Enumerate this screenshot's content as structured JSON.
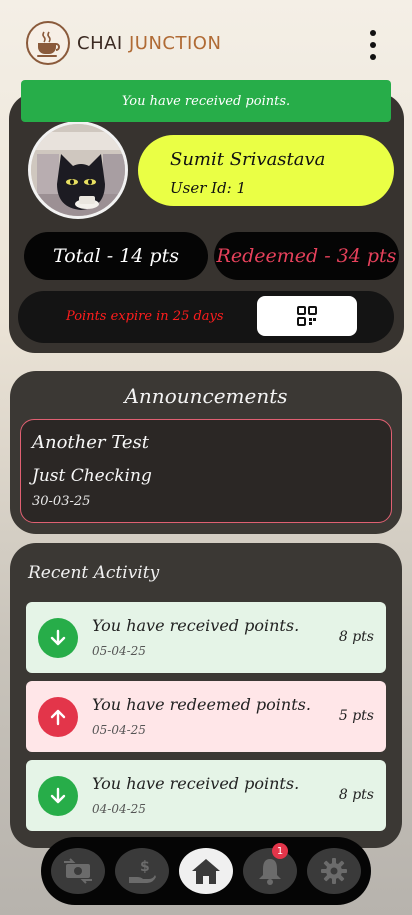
{
  "header": {
    "brand_part1": "CHAI",
    "brand_part2": "JUNCTION",
    "logo_icon": "coffee-cup-icon",
    "menu_icon": "more-vertical-icon"
  },
  "toast": {
    "message": "You have received points."
  },
  "profile": {
    "name": "Sumit Srivastava",
    "user_id": "User Id: 1",
    "avatar_icon": "cat-avatar-icon"
  },
  "points": {
    "total": "Total - 14 pts",
    "redeemed": "Redeemed - 34 pts",
    "expiry": "Points expire in 25 days",
    "qr_icon": "qr-code-icon"
  },
  "announcements": {
    "title": "Announcements",
    "items": [
      {
        "title": "Another Test",
        "body": "Just Checking",
        "date": "30-03-25"
      }
    ]
  },
  "activity": {
    "title": "Recent Activity",
    "items": [
      {
        "type": "received",
        "message": "You have received points.",
        "date": "05-04-25",
        "points": "8 pts",
        "icon": "arrow-down-icon"
      },
      {
        "type": "redeemed",
        "message": "You have redeemed points.",
        "date": "05-04-25",
        "points": "5 pts",
        "icon": "arrow-up-icon"
      },
      {
        "type": "received",
        "message": "You have received points.",
        "date": "04-04-25",
        "points": "8 pts",
        "icon": "arrow-down-icon"
      }
    ]
  },
  "nav": {
    "items": [
      {
        "name": "exchange",
        "icon": "money-exchange-icon"
      },
      {
        "name": "redeem",
        "icon": "hand-dollar-icon"
      },
      {
        "name": "home",
        "icon": "home-icon",
        "active": true
      },
      {
        "name": "notifications",
        "icon": "bell-icon",
        "badge": "1"
      },
      {
        "name": "settings",
        "icon": "gear-icon"
      }
    ]
  },
  "colors": {
    "received": "#27ad49",
    "redeemed": "#e3354a",
    "highlight": "#eaff45",
    "card": "#3b3834"
  }
}
